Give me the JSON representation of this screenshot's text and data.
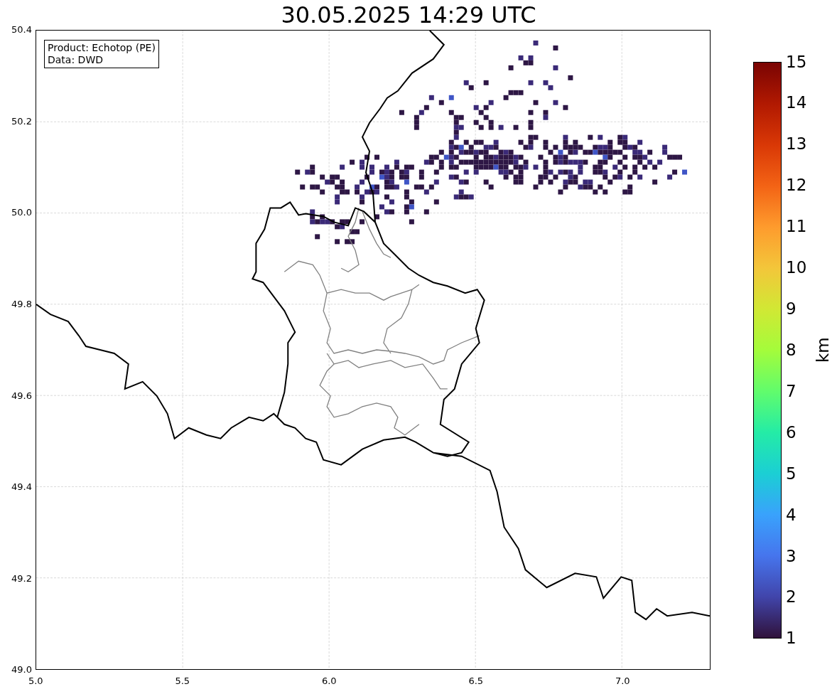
{
  "title": "30.05.2025 14:29 UTC",
  "legend": [
    "Product: Echotop (PE)",
    "Data: DWD"
  ],
  "map": {
    "yticks": [
      "50.4",
      "50.2",
      "50.0",
      "49.8",
      "49.6",
      "49.4",
      "49.2",
      "49.0"
    ],
    "xticks": [
      "5.0",
      "5.5",
      "6.0",
      "6.5",
      "7.0"
    ]
  },
  "colorbar": {
    "ticks": [
      "15",
      "14",
      "13",
      "12",
      "11",
      "10",
      "9",
      "8",
      "7",
      "6",
      "5",
      "4",
      "3",
      "2",
      "1"
    ],
    "label": "km"
  }
}
